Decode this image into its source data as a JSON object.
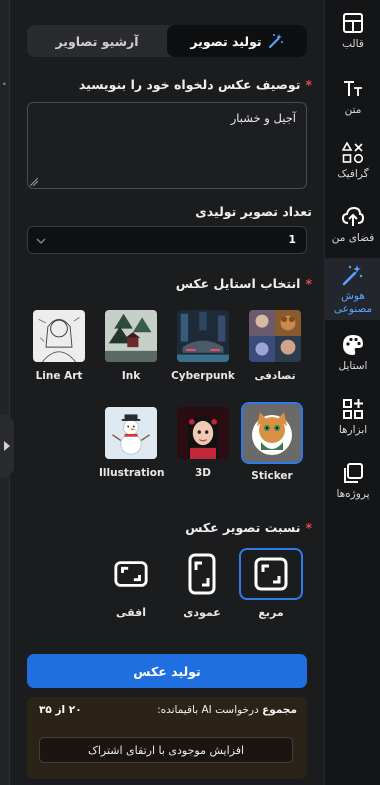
{
  "tabs": {
    "generate_label": "تولید تصویر",
    "archive_label": "آرشیو تصاویر"
  },
  "prompt": {
    "label": "توصیف عکس دلخواه خود را بنویسید",
    "value": "آجیل و خشبار"
  },
  "count": {
    "label": "تعداد تصویر تولیدی",
    "value": "1"
  },
  "styles": {
    "label": "انتخاب استایل عکس",
    "items": [
      {
        "name": "تصادفی",
        "selected": false
      },
      {
        "name": "Cyberpunk",
        "selected": false
      },
      {
        "name": "Ink",
        "selected": false
      },
      {
        "name": "Line Art",
        "selected": false
      },
      {
        "name": "Sticker",
        "selected": true
      },
      {
        "name": "3D",
        "selected": false
      },
      {
        "name": "Illustration",
        "selected": false
      }
    ]
  },
  "ratio": {
    "label": "نسبت تصویر عکس",
    "items": [
      {
        "name": "مربع",
        "selected": true
      },
      {
        "name": "عمودی",
        "selected": false
      },
      {
        "name": "افقی",
        "selected": false
      }
    ]
  },
  "generate_button": "تولید عکس",
  "credits": {
    "total_label": "مجموع",
    "remaining_text": "درخواست AI باقیمانده:",
    "count_text": "۲۰ از ۳۵",
    "upgrade_label": "افزایش موجودی با ارتقای اشتراک"
  },
  "sidebar": {
    "items": [
      {
        "label": "قالب",
        "icon": "template-icon"
      },
      {
        "label": "متن",
        "icon": "text-icon"
      },
      {
        "label": "گرافیک",
        "icon": "shapes-icon"
      },
      {
        "label": "فضای من",
        "icon": "cloud-upload-icon"
      },
      {
        "label": "هوش مصنوعی",
        "icon": "magic-wand-icon",
        "active": true
      },
      {
        "label": "استایل",
        "icon": "palette-icon"
      },
      {
        "label": "ابزارها",
        "icon": "tools-icon"
      },
      {
        "label": "پروژه‌ها",
        "icon": "projects-icon"
      }
    ]
  },
  "colors": {
    "accent": "#1f6fe0",
    "active_text": "#5aa4ff",
    "required": "#e24a4a"
  }
}
